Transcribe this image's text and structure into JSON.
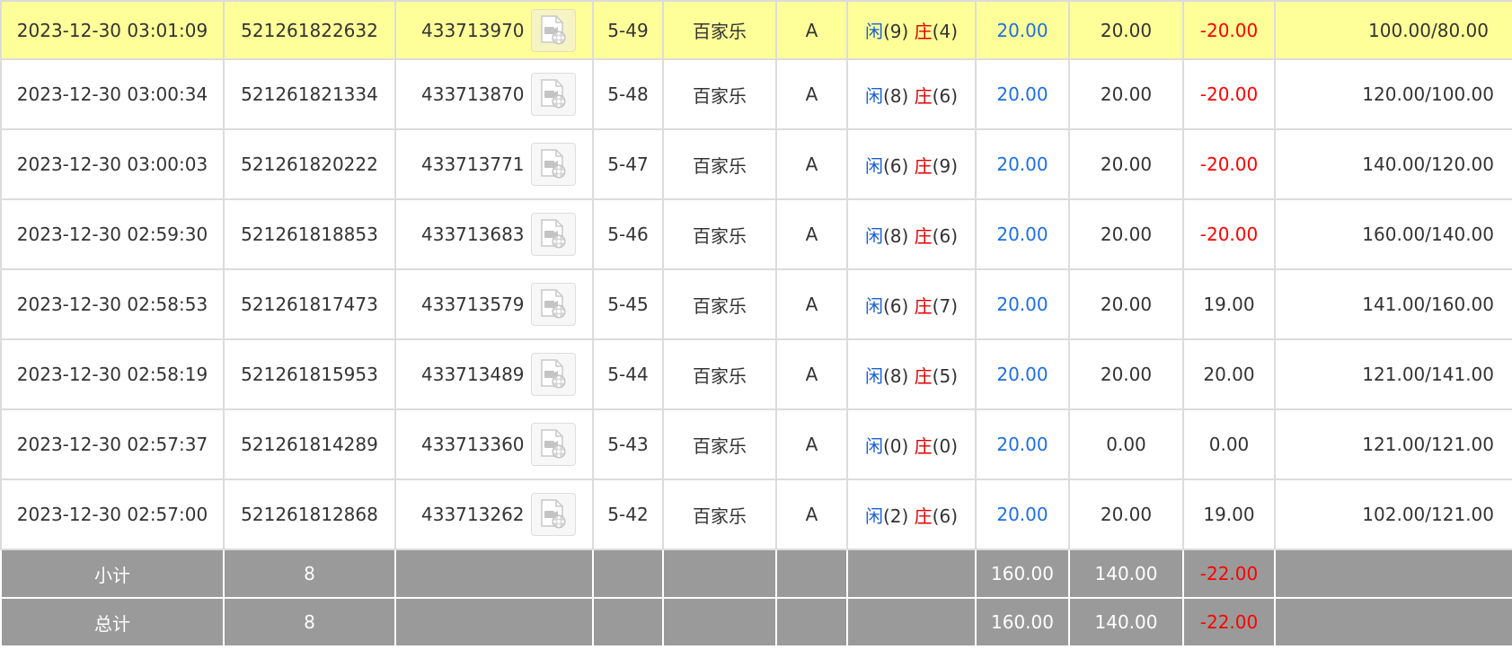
{
  "rows": [
    {
      "time": "2023-12-30 03:01:09",
      "bet_id": "521261822632",
      "round_id": "433713970",
      "shoe": "5-49",
      "game": "百家乐",
      "table": "A",
      "player_label": "闲",
      "player_score": "(9)",
      "banker_label": "庄",
      "banker_score": "(4)",
      "bet_amount": "20.00",
      "valid_bet": "20.00",
      "win_loss": "-20.00",
      "win_negative": true,
      "balance": "100.00/80.00",
      "highlighted": true
    },
    {
      "time": "2023-12-30 03:00:34",
      "bet_id": "521261821334",
      "round_id": "433713870",
      "shoe": "5-48",
      "game": "百家乐",
      "table": "A",
      "player_label": "闲",
      "player_score": "(8)",
      "banker_label": "庄",
      "banker_score": "(6)",
      "bet_amount": "20.00",
      "valid_bet": "20.00",
      "win_loss": "-20.00",
      "win_negative": true,
      "balance": "120.00/100.00",
      "highlighted": false
    },
    {
      "time": "2023-12-30 03:00:03",
      "bet_id": "521261820222",
      "round_id": "433713771",
      "shoe": "5-47",
      "game": "百家乐",
      "table": "A",
      "player_label": "闲",
      "player_score": "(6)",
      "banker_label": "庄",
      "banker_score": "(9)",
      "bet_amount": "20.00",
      "valid_bet": "20.00",
      "win_loss": "-20.00",
      "win_negative": true,
      "balance": "140.00/120.00",
      "highlighted": false
    },
    {
      "time": "2023-12-30 02:59:30",
      "bet_id": "521261818853",
      "round_id": "433713683",
      "shoe": "5-46",
      "game": "百家乐",
      "table": "A",
      "player_label": "闲",
      "player_score": "(8)",
      "banker_label": "庄",
      "banker_score": "(6)",
      "bet_amount": "20.00",
      "valid_bet": "20.00",
      "win_loss": "-20.00",
      "win_negative": true,
      "balance": "160.00/140.00",
      "highlighted": false
    },
    {
      "time": "2023-12-30 02:58:53",
      "bet_id": "521261817473",
      "round_id": "433713579",
      "shoe": "5-45",
      "game": "百家乐",
      "table": "A",
      "player_label": "闲",
      "player_score": "(6)",
      "banker_label": "庄",
      "banker_score": "(7)",
      "bet_amount": "20.00",
      "valid_bet": "20.00",
      "win_loss": "19.00",
      "win_negative": false,
      "balance": "141.00/160.00",
      "highlighted": false
    },
    {
      "time": "2023-12-30 02:58:19",
      "bet_id": "521261815953",
      "round_id": "433713489",
      "shoe": "5-44",
      "game": "百家乐",
      "table": "A",
      "player_label": "闲",
      "player_score": "(8)",
      "banker_label": "庄",
      "banker_score": "(5)",
      "bet_amount": "20.00",
      "valid_bet": "20.00",
      "win_loss": "20.00",
      "win_negative": false,
      "balance": "121.00/141.00",
      "highlighted": false
    },
    {
      "time": "2023-12-30 02:57:37",
      "bet_id": "521261814289",
      "round_id": "433713360",
      "shoe": "5-43",
      "game": "百家乐",
      "table": "A",
      "player_label": "闲",
      "player_score": "(0)",
      "banker_label": "庄",
      "banker_score": "(0)",
      "bet_amount": "20.00",
      "valid_bet": "0.00",
      "win_loss": "0.00",
      "win_negative": false,
      "balance": "121.00/121.00",
      "highlighted": false
    },
    {
      "time": "2023-12-30 02:57:00",
      "bet_id": "521261812868",
      "round_id": "433713262",
      "shoe": "5-42",
      "game": "百家乐",
      "table": "A",
      "player_label": "闲",
      "player_score": "(2)",
      "banker_label": "庄",
      "banker_score": "(6)",
      "bet_amount": "20.00",
      "valid_bet": "20.00",
      "win_loss": "19.00",
      "win_negative": false,
      "balance": "102.00/121.00",
      "highlighted": false
    }
  ],
  "summary": {
    "subtotal": {
      "label": "小计",
      "count": "8",
      "bet_amount": "160.00",
      "valid_bet": "140.00",
      "win_loss": "-22.00"
    },
    "total": {
      "label": "总计",
      "count": "8",
      "bet_amount": "160.00",
      "valid_bet": "140.00",
      "win_loss": "-22.00"
    }
  },
  "icons": {
    "replay": "video-replay-icon"
  },
  "colors": {
    "highlight_row": "#ffff99",
    "player": "#1a5fd0",
    "banker": "#e00000",
    "negative": "#ff0000",
    "bet_amount": "#1e6fe6",
    "summary_bg": "#9a9a9a"
  }
}
